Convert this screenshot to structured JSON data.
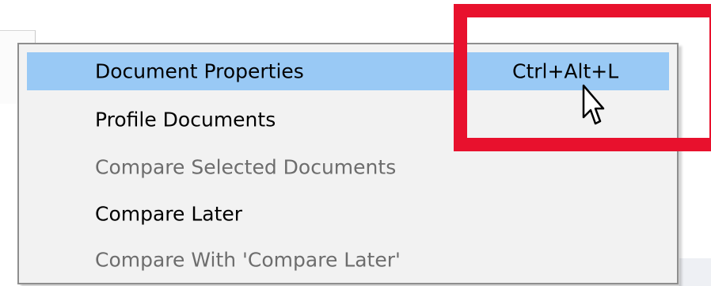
{
  "context_menu": {
    "items": [
      {
        "label": "Document Properties",
        "shortcut": "Ctrl+Alt+L",
        "state": "highlighted"
      },
      {
        "label": "Profile Documents",
        "shortcut": "",
        "state": "enabled"
      },
      {
        "label": "Compare Selected Documents",
        "shortcut": "",
        "state": "disabled"
      },
      {
        "label": "Compare Later",
        "shortcut": "",
        "state": "enabled"
      },
      {
        "label": "Compare With 'Compare Later'",
        "shortcut": "",
        "state": "disabled"
      }
    ]
  },
  "annotation": {
    "color": "#e8112d"
  },
  "colors": {
    "highlight": "#99c9f5",
    "menu_background": "#f2f2f2",
    "disabled_text": "#6d6d6d"
  },
  "icons": {
    "cursor": "arrow-cursor-icon"
  }
}
